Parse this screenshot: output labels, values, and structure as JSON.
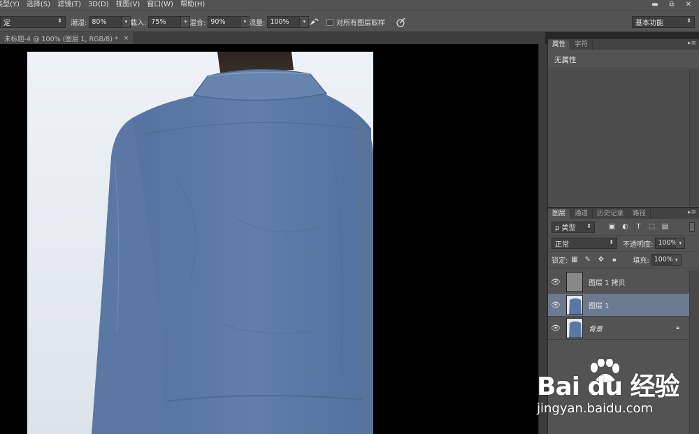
{
  "menubar": {
    "items": [
      "类型(Y)",
      "选择(S)",
      "滤镜(T)",
      "3D(D)",
      "视图(V)",
      "窗口(W)",
      "帮助(H)"
    ],
    "win_minimize": "▬",
    "win_restore": "⧉",
    "win_close": "✕"
  },
  "options": {
    "mode_value": "定",
    "wetness_label": "潮湿:",
    "wetness_value": "80%",
    "load_label": "载入:",
    "load_value": "75%",
    "mix_label": "混合:",
    "mix_value": "90%",
    "flow_label": "流量:",
    "flow_value": "100%",
    "sample_all_label": "对所有图层取样",
    "workspace_value": "基本功能"
  },
  "document": {
    "tab_title": "未标题-4 @ 100% (图层 1, RGB/8) *",
    "close": "×"
  },
  "properties_panel": {
    "tabs": [
      "属性",
      "字符"
    ],
    "no_properties": "无属性",
    "menu_glyph": "▸≡"
  },
  "layers_panel": {
    "tabs": [
      "图层",
      "通道",
      "历史记录",
      "路径"
    ],
    "menu_glyph": "▸≡",
    "filter_value": "ρ 类型",
    "blend_mode": "正常",
    "opacity_label": "不透明度:",
    "opacity_value": "100%",
    "lock_label": "锁定:",
    "fill_label": "填充:",
    "fill_value": "100%",
    "layers": [
      {
        "name": "图层 1 拷贝",
        "selected": false,
        "visible": true
      },
      {
        "name": "图层 1",
        "selected": true,
        "visible": true
      },
      {
        "name": "背景",
        "selected": false,
        "visible": true,
        "locked": true
      }
    ]
  },
  "watermark": {
    "logo_text": "Bai du 经验",
    "url": "jingyan.baidu.com"
  },
  "colors": {
    "selected_layer": "#6c7a90",
    "panel_bg": "#535353",
    "shirt": "#5c79a4"
  }
}
